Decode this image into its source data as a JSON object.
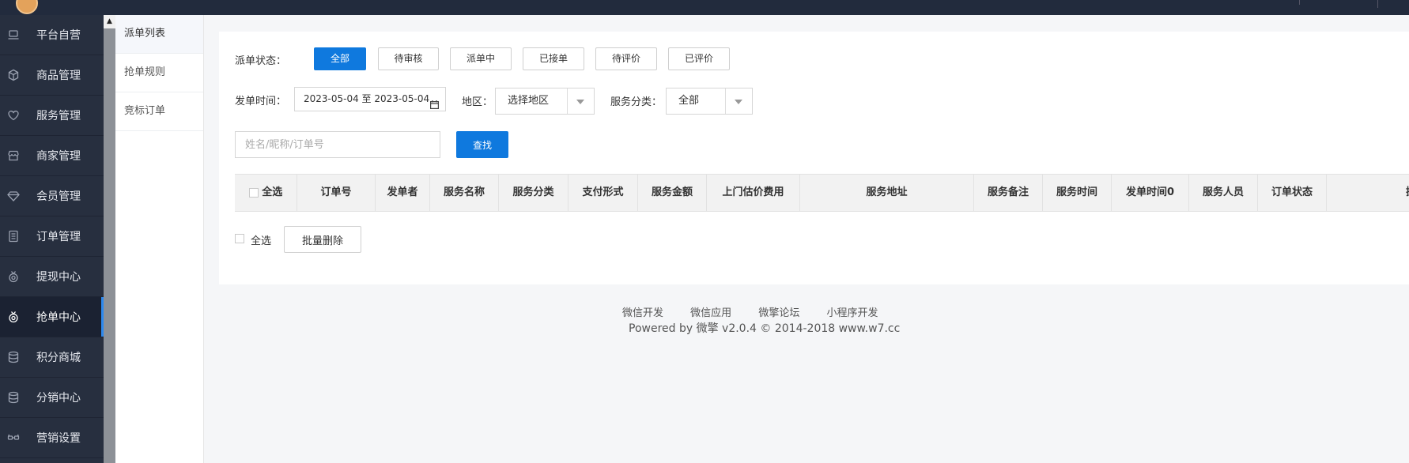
{
  "sidebar": {
    "items": [
      {
        "label": "平台自营",
        "icon": "laptop-icon"
      },
      {
        "label": "商品管理",
        "icon": "box-icon"
      },
      {
        "label": "服务管理",
        "icon": "heart-icon"
      },
      {
        "label": "商家管理",
        "icon": "store-icon"
      },
      {
        "label": "会员管理",
        "icon": "diamond-icon"
      },
      {
        "label": "订单管理",
        "icon": "list-icon"
      },
      {
        "label": "提现中心",
        "icon": "medal-icon"
      },
      {
        "label": "抢单中心",
        "icon": "medal-icon",
        "active": true
      },
      {
        "label": "积分商城",
        "icon": "database-icon"
      },
      {
        "label": "分销中心",
        "icon": "database-icon"
      },
      {
        "label": "营销设置",
        "icon": "glasses-icon"
      }
    ]
  },
  "subnav": {
    "items": [
      "派单列表",
      "抢单规则",
      "竞标订单"
    ]
  },
  "filters": {
    "status_label": "派单状态：",
    "status_options": [
      "全部",
      "待审核",
      "派单中",
      "已接单",
      "待评价",
      "已评价"
    ],
    "time_label": "发单时间：",
    "date_range": "2023-05-04 至 2023-05-04",
    "region_label": "地区：",
    "region_value": "选择地区",
    "category_label": "服务分类：",
    "category_value": "全部"
  },
  "search": {
    "placeholder": "姓名/昵称/订单号",
    "button": "查找"
  },
  "table": {
    "select_all": "全选",
    "columns": [
      "订单号",
      "发单者",
      "服务名称",
      "服务分类",
      "支付形式",
      "服务金额",
      "上门估价费用",
      "服务地址",
      "服务备注",
      "服务时间",
      "发单时间0",
      "服务人员",
      "订单状态",
      "操作"
    ]
  },
  "bulk": {
    "select_all": "全选",
    "delete_button": "批量删除"
  },
  "footer": {
    "links": [
      "微信开发",
      "微信应用",
      "微擎论坛",
      "小程序开发"
    ],
    "powered": "Powered by 微擎 v2.0.4 © 2014-2018 www.w7.cc"
  },
  "colors": {
    "primary": "#0f79de",
    "sidebar_bg": "#272f3f",
    "topbar_bg": "#222b3d"
  }
}
